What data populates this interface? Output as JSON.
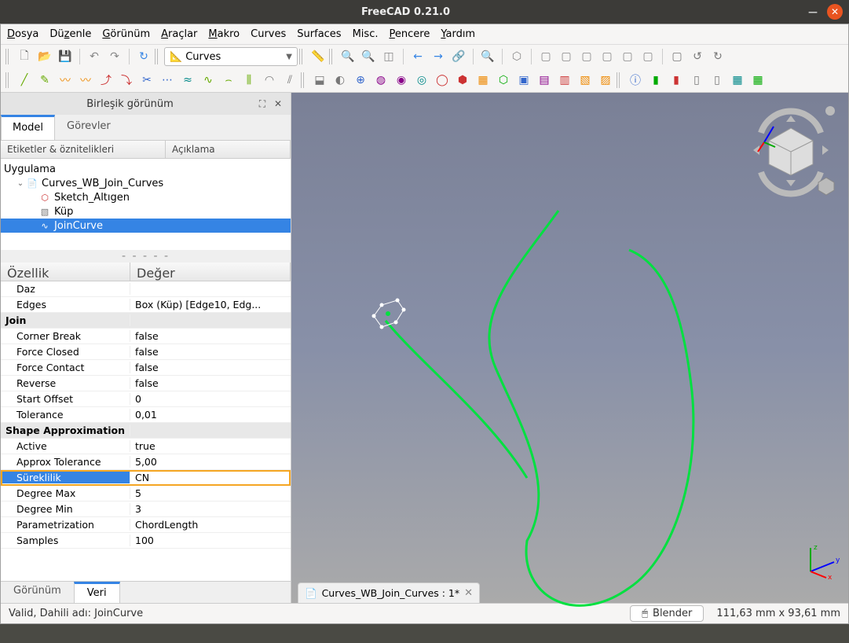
{
  "titlebar": {
    "title": "FreeCAD 0.21.0"
  },
  "menu": {
    "file": "Dosya",
    "edit": "Düzenle",
    "view": "Görünüm",
    "tools": "Araçlar",
    "macro": "Makro",
    "curves": "Curves",
    "surfaces": "Surfaces",
    "misc": "Misc.",
    "windows": "Pencere",
    "help": "Yardım"
  },
  "workbench": {
    "name": "Curves"
  },
  "panel": {
    "title": "Birleşik görünüm"
  },
  "tabs": {
    "model": "Model",
    "tasks": "Görevler"
  },
  "tree": {
    "col1": "Etiketler & öznitelikleri",
    "col2": "Açıklama",
    "root": "Uygulama",
    "doc": "Curves_WB_Join_Curves",
    "items": [
      "Sketch_Altıgen",
      "Küp",
      "JoinCurve"
    ]
  },
  "splitter": "- - - - -",
  "props": {
    "col1": "Özellik",
    "col2": "Değer",
    "rows": [
      {
        "k": "Daz",
        "v": "",
        "indent": true
      },
      {
        "k": "Edges",
        "v": "Box (Küp) [Edge10, Edg...",
        "indent": true
      },
      {
        "k": "Join",
        "v": "",
        "group": true
      },
      {
        "k": "Corner Break",
        "v": "false",
        "indent": true
      },
      {
        "k": "Force Closed",
        "v": "false",
        "indent": true
      },
      {
        "k": "Force Contact",
        "v": "false",
        "indent": true
      },
      {
        "k": "Reverse",
        "v": "false",
        "indent": true
      },
      {
        "k": "Start Offset",
        "v": "0",
        "indent": true
      },
      {
        "k": "Tolerance",
        "v": "0,01",
        "indent": true
      },
      {
        "k": "Shape Approximation",
        "v": "",
        "group": true
      },
      {
        "k": "Active",
        "v": "true",
        "indent": true
      },
      {
        "k": "Approx Tolerance",
        "v": "5,00",
        "indent": true
      },
      {
        "k": "Süreklilik",
        "v": "CN",
        "indent": true,
        "selected": true
      },
      {
        "k": "Degree Max",
        "v": "5",
        "indent": true
      },
      {
        "k": "Degree Min",
        "v": "3",
        "indent": true
      },
      {
        "k": "Parametrization",
        "v": "ChordLength",
        "indent": true
      },
      {
        "k": "Samples",
        "v": "100",
        "indent": true
      }
    ]
  },
  "bottom_tabs": {
    "view": "Görünüm",
    "data": "Veri"
  },
  "doc_tab": "Curves_WB_Join_Curves : 1*",
  "status": {
    "left": "Valid, Dahili adı: JoinCurve",
    "button": "Blender",
    "coords": "111,63 mm x 93,61 mm"
  },
  "axis": {
    "x": "x",
    "y": "y",
    "z": "z"
  }
}
